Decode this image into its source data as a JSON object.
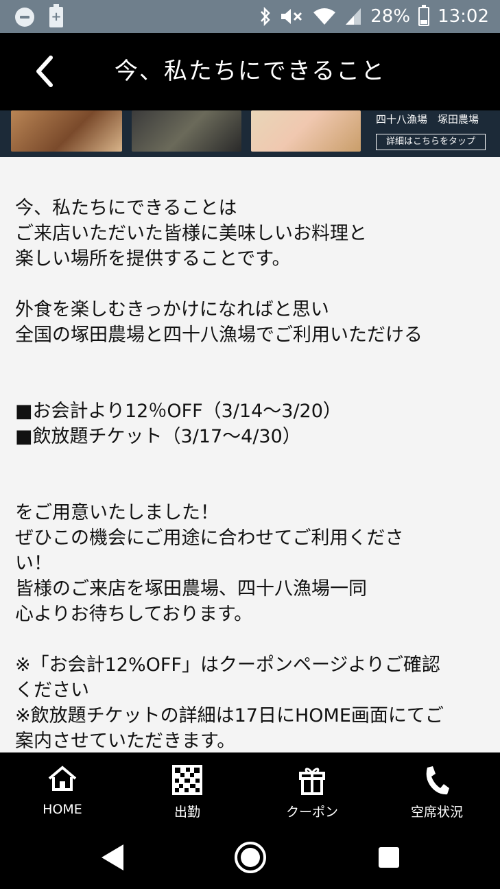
{
  "status_bar": {
    "battery": "28%",
    "time": "13:02"
  },
  "header": {
    "title": "今、私たちにできること"
  },
  "banner": {
    "store_names": "四十八漁場　塚田農場",
    "cta": "詳細はこちらをタップ"
  },
  "content": {
    "p1": [
      "今、私たちにできることは",
      "ご来店いただいた皆様に美味しいお料理と",
      "楽しい場所を提供することです。"
    ],
    "p2": [
      "外食を楽しむきっかけになればと思い",
      "全国の塚田農場と四十八漁場でご利用いただける"
    ],
    "p3": [
      "■お会計より12％OFF（3/14〜3/20）",
      "■飲放題チケット（3/17〜4/30）"
    ],
    "p4": [
      "をご用意いたしました！",
      "ぜひこの機会にご用途に合わせてご利用くださ",
      "い！",
      "皆様のご来店を塚田農場、四十八漁場一同",
      "心よりお待ちしております。"
    ],
    "p5": [
      "※「お会計12%OFF」はクーポンページよりご確認",
      "ください",
      "※飲放題チケットの詳細は17日にHOME画面にてご",
      "案内させていただきます。"
    ]
  },
  "tabs": [
    {
      "label": "HOME",
      "icon": "home-icon"
    },
    {
      "label": "出勤",
      "icon": "qr-code-icon"
    },
    {
      "label": "クーポン",
      "icon": "gift-icon"
    },
    {
      "label": "空席状況",
      "icon": "phone-icon"
    }
  ],
  "colors": {
    "status_bar": "#6f7f8c",
    "header": "#000000",
    "background": "#f4f4f4"
  }
}
